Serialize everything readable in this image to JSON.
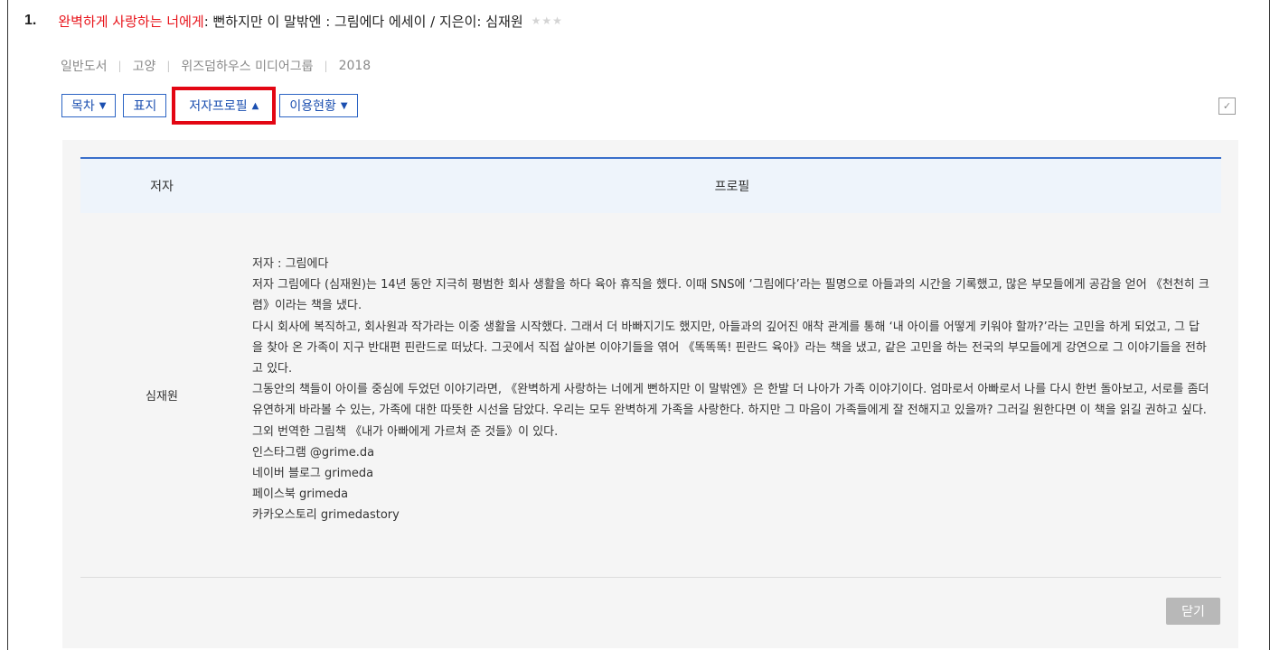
{
  "item": {
    "number": "1.",
    "title_highlight": "완벽하게 사랑하는 너에게",
    "title_rest": " : 뻔하지만 이 말밖엔 : 그림에다 에세이 / 지은이: 심재원",
    "stars": "★★★"
  },
  "meta": {
    "type": "일반도서",
    "location": "고양",
    "publisher": "위즈덤하우스 미디어그룹",
    "year": "2018",
    "separator": "|"
  },
  "tabs": [
    {
      "label": "목차",
      "arrow": "▼"
    },
    {
      "label": "표지",
      "arrow": ""
    },
    {
      "label": "저자프로필",
      "arrow": "▲"
    },
    {
      "label": "이용현황",
      "arrow": "▼"
    }
  ],
  "table": {
    "header_author": "저자",
    "header_profile": "프로필",
    "author_name": "심재원",
    "profile_lines": [
      "저자 : 그림에다",
      "저자 그림에다 (심재원)는 14년 동안 지극히 평범한 회사 생활을 하다 육아 휴직을 했다. 이때 SNS에 ‘그림에다’라는 필명으로 아들과의 시간을 기록했고, 많은 부모들에게 공감을 얻어 《천천히 크렴》이라는 책을 냈다.",
      "다시 회사에 복직하고, 회사원과 작가라는 이중 생활을 시작했다. 그래서 더 바빠지기도 했지만, 아들과의 깊어진 애착 관계를 통해 ‘내 아이를 어떻게 키워야 할까?’라는 고민을 하게 되었고, 그 답을 찾아 온 가족이 지구 반대편 핀란드로 떠났다. 그곳에서 직접 살아본 이야기들을 엮어 《똑똑똑! 핀란드 육아》라는 책을 냈고, 같은 고민을 하는 전국의 부모들에게 강연으로 그 이야기들을 전하고 있다.",
      "그동안의 책들이 아이를 중심에 두었던 이야기라면, 《완벽하게 사랑하는 너에게 뻔하지만 이 말밖엔》은 한발 더 나아가 가족 이야기이다. 엄마로서 아빠로서 나를 다시 한번 돌아보고, 서로를 좀더 유연하게 바라볼 수 있는, 가족에 대한 따뜻한 시선을 담았다. 우리는 모두 완벽하게 가족을 사랑한다. 하지만 그 마음이 가족들에게 잘 전해지고 있을까? 그러길 원한다면 이 책을 읽길 권하고 싶다.",
      "그외 번역한 그림책 《내가 아빠에게 가르쳐 준 것들》이 있다.",
      "인스타그램 @grime.da",
      "네이버 블로그 grimeda",
      "페이스북 grimeda",
      "카카오스토리 grimedastory"
    ]
  },
  "buttons": {
    "close": "닫기"
  },
  "colors": {
    "title_highlight": "#e8141b",
    "tab_border": "#2b64c4",
    "active_tab_outline": "#e30613",
    "table_top_line": "#3a6fca"
  }
}
